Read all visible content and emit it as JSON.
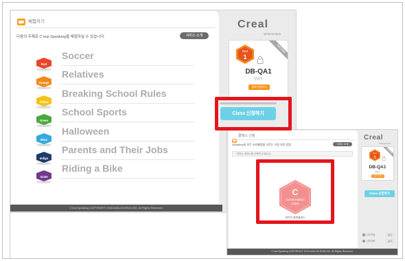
{
  "trial": {
    "title": "체험하기",
    "intro": "다음의 주제로 C'real Speaking을 체험하실 수 있습니다.",
    "service_button": "서비스 소개",
    "topics": [
      {
        "label": "Soccer",
        "badge": "Red",
        "color": "#e8452c"
      },
      {
        "label": "Relatives",
        "badge": "Orange",
        "color": "#f08a1c"
      },
      {
        "label": "Breaking School Rules",
        "badge": "Yellow",
        "color": "#f4c21a"
      },
      {
        "label": "School Sports",
        "badge": "Green",
        "color": "#4aa83c"
      },
      {
        "label": "Halloween",
        "badge": "Blue",
        "color": "#36a9de"
      },
      {
        "label": "Parents and Their Jobs",
        "badge": "Indigo",
        "color": "#1e3a6c"
      },
      {
        "label": "Riding a Bike",
        "badge": "Violet",
        "color": "#72398d"
      }
    ],
    "footer": "C'real Speaking COPYRIGHT 2015 AVALON ENGLISH. All Rights Reserved."
  },
  "profile": {
    "logo": "Creal",
    "logo_sub": "SPEAKING",
    "ribbon": "체험진행중",
    "level_name": "Red",
    "level_number": "1",
    "user_id": "DB-QA1",
    "user_name": "민남구",
    "action_button": "정보수정하기",
    "class_button": "Class 신청하기"
  },
  "class_request": {
    "title": "클래스 신청",
    "subtitle": "Speaking의 모든 커리큘럼을 기르는 가장 쉬운 방법",
    "service_button": "서비스 소개",
    "select_placeholder": "* 원하는 클래스를 선택해 주세요(1)",
    "class_card": {
      "letter": "C",
      "name_line1": "Conversation",
      "name_line2": "Class",
      "caption": "원어민 회화클래스",
      "color": "#f3908f"
    },
    "profile": {
      "logo": "Creal",
      "logo_sub": "SPEAKING",
      "ribbon": "체험진행중",
      "level_name": "Red",
      "level_number": "1",
      "user_id": "DB-QA1",
      "user_name": "민남구",
      "action_button": "정보수정하기",
      "class_button": "Class 신청하기"
    },
    "menu": [
      {
        "label": "나의 학습",
        "button": "보기"
      },
      {
        "label": "나의 정보",
        "button": "보기"
      }
    ],
    "footer": "C'real Speaking COPYRIGHT 2015 AVALON ENGLISH. All Rights Reserved."
  },
  "icons": {
    "header": "speech-bubble-icon",
    "topic_badge": "hexagon-badge-icon",
    "level_badge": "level-hexagon-icon",
    "lock": "lock-icon",
    "class_card": "hexagon-class-icon"
  },
  "colors": {
    "highlight": "#e5141c",
    "class_button": "#6dd1e6",
    "orange_button": "#f7941d",
    "level_badge": "#f58a1f",
    "footer": "#575757",
    "topic_text": "#acacac"
  }
}
